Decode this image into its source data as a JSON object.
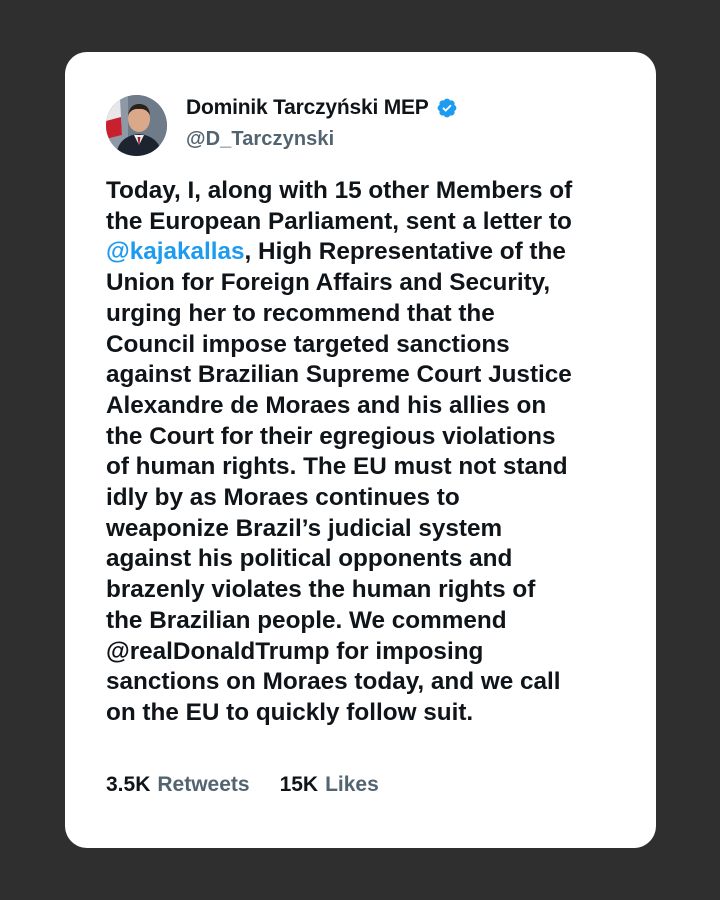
{
  "author": {
    "display_name": "Dominik Tarczyński MEP",
    "handle": "@D_Tarczynski",
    "verified_icon": "verified-badge-icon",
    "avatar_icon": "profile-photo"
  },
  "tweet": {
    "lines": [
      [
        {
          "text": "Today, I, along with 15 other Members of",
          "mention": false
        }
      ],
      [
        {
          "text": "the European Parliament, sent a letter to",
          "mention": false
        }
      ],
      [
        {
          "text": "@kajakallas",
          "mention": true
        },
        {
          "text": ", High Representative of the",
          "mention": false
        }
      ],
      [
        {
          "text": "Union for Foreign Affairs and Security,",
          "mention": false
        }
      ],
      [
        {
          "text": "urging her to recommend that the",
          "mention": false
        }
      ],
      [
        {
          "text": "Council impose targeted sanctions",
          "mention": false
        }
      ],
      [
        {
          "text": "against Brazilian Supreme Court Justice",
          "mention": false
        }
      ],
      [
        {
          "text": "Alexandre de Moraes and his allies on",
          "mention": false
        }
      ],
      [
        {
          "text": "the Court for their egregious violations",
          "mention": false
        }
      ],
      [
        {
          "text": "of human rights. The EU must not stand",
          "mention": false
        }
      ],
      [
        {
          "text": "idly by as Moraes continues to",
          "mention": false
        }
      ],
      [
        {
          "text": "weaponize Brazil’s judicial system",
          "mention": false
        }
      ],
      [
        {
          "text": "against his political opponents and",
          "mention": false
        }
      ],
      [
        {
          "text": "brazenly violates the human rights of",
          "mention": false
        }
      ],
      [
        {
          "text": "the Brazilian people. We commend",
          "mention": false
        }
      ],
      [
        {
          "text": "@realDonaldTrump for imposing",
          "mention": false
        }
      ],
      [
        {
          "text": "sanctions on Moraes today, and we call",
          "mention": false
        }
      ],
      [
        {
          "text": "on the EU to quickly follow suit.",
          "mention": false
        }
      ]
    ]
  },
  "stats": {
    "retweets_count": "3.5K",
    "retweets_label": "Retweets",
    "likes_count": "15K",
    "likes_label": "Likes"
  },
  "colors": {
    "background": "#2f2f30",
    "card": "#ffffff",
    "text": "#0f1419",
    "secondary": "#536471",
    "mention": "#1d9bf0",
    "verified": "#1d9bf0"
  }
}
